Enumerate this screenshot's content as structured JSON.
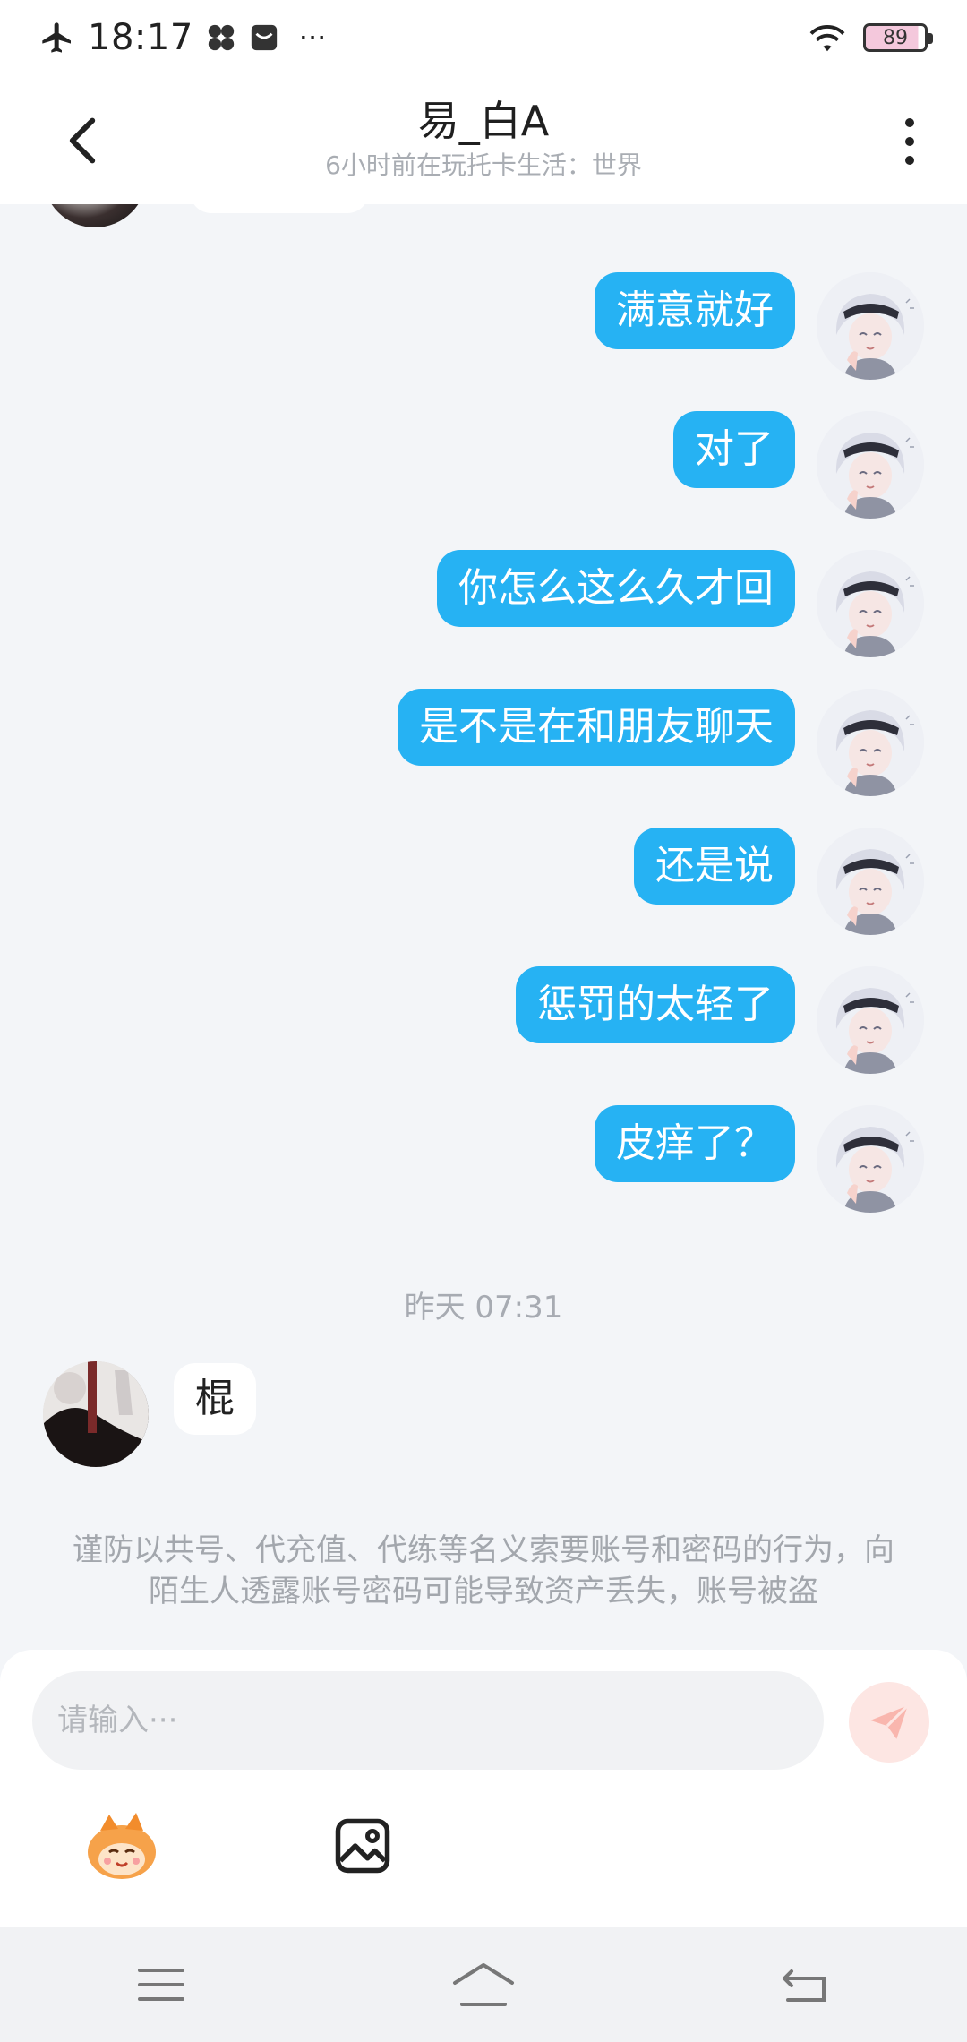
{
  "status_bar": {
    "time": "18:17",
    "more": "···",
    "battery": "89"
  },
  "header": {
    "title": "易_白A",
    "subtitle": "6小时前在玩托卡生活：世界"
  },
  "messages_out": [
    {
      "text": "满意就好"
    },
    {
      "text": "对了"
    },
    {
      "text": "你怎么这么久才回"
    },
    {
      "text": "是不是在和朋友聊天"
    },
    {
      "text": "还是说"
    },
    {
      "text": "惩罚的太轻了"
    },
    {
      "text": "皮痒了？"
    }
  ],
  "timestamp": "昨天 07:31",
  "message_in": {
    "text": "棍"
  },
  "notice": "谨防以共号、代充值、代练等名义索要账号和密码的行为，向陌生人透露账号密码可能导致资产丢失，账号被盗",
  "composer": {
    "placeholder": "请输入···"
  },
  "colors": {
    "bubble_out": "#26b2f3",
    "bubble_in": "#ffffff",
    "background": "#f3f5f8",
    "send_button": "#fde6e3"
  }
}
